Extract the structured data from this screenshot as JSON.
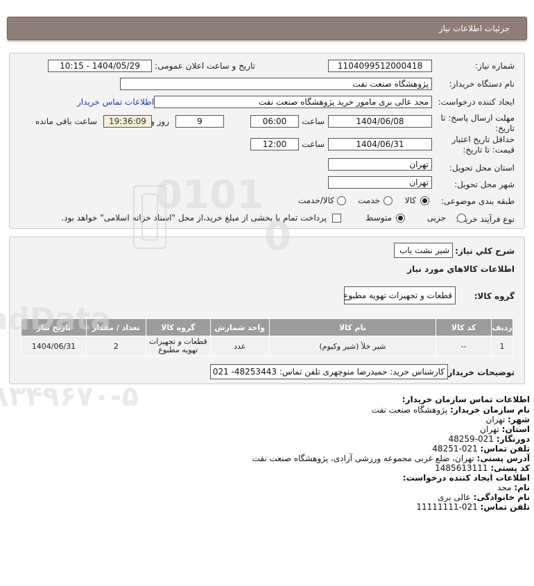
{
  "header": {
    "title": "جزئیات اطلاعات نیاز"
  },
  "form": {
    "need_number_label": "شماره نیاز:",
    "need_number": "1104099512000418",
    "announce_label": "تاریخ و ساعت اعلان عمومی:",
    "announce_value": "1404/05/29 - 10:15",
    "buyer_org_label": "نام دستگاه خریدار:",
    "buyer_org": "پژوهشگاه صنعت نفت",
    "creator_label": "ایجاد کننده درخواست:",
    "creator": "مجد عالی بری مامور خرید پژوهشگاه صنعت نفت",
    "contact_link": "اطلاعات تماس خریدار",
    "deadline_label_1": "مهلت ارسال پاسخ: تا",
    "deadline_label_2": "تاریخ:",
    "deadline_date": "1404/06/08",
    "time_label": "ساعت",
    "deadline_time": "06:00",
    "days": "9",
    "days_label": "روز و",
    "remaining_time": "19:36:09",
    "remaining_label": "ساعت باقی مانده",
    "validity_label_1": "حداقل تاریخ اعتبار",
    "validity_label_2": "قیمت: تا تاریخ:",
    "validity_date": "1404/06/31",
    "validity_time": "12:00",
    "province_label": "استان محل تحویل:",
    "province": "تهران",
    "city_label": "شهر محل تحویل:",
    "city": "تهران",
    "category_label": "طبقه بندی موضوعی:",
    "category_options": [
      "کالا",
      "خدمت",
      "کالا/خدمت"
    ],
    "category_selected": "کالا",
    "process_label": "نوع فرآیند خرید :",
    "process_options": [
      "جزیی",
      "متوسط"
    ],
    "process_selected": "متوسط",
    "payment_note": "پرداخت تمام یا بخشی از مبلغ خرید،از محل \"اسناد خزانه اسلامی\" خواهد بود."
  },
  "details": {
    "summary_label": "شرح کلي نياز:",
    "summary": "شیر نشت یاب",
    "goods_info_title": "اطلاعات کالاهاي مورد نياز",
    "group_label": "گروه کالا:",
    "group": "قطعات و تجهیزات تهویه مطبوع",
    "table": {
      "headers": [
        "ردیف",
        "کد کالا",
        "نام کالا",
        "واحد شمارش",
        "گروه کالا",
        "تعداد / مقدار",
        "تاریخ نیاز"
      ],
      "rows": [
        [
          "1",
          "--",
          "شیر خلأ (شیر وکیوم)",
          "عدد",
          "قطعات و تجهیزات تهویه مطبوع",
          "2",
          "1404/06/31"
        ]
      ]
    },
    "buyer_notes_label": "توضیحات خریدار:",
    "buyer_notes": "کارشناس خرید: حمیدرضا منوچهری تلفن تماس: 48253443- 021"
  },
  "contact": {
    "title": "اطلاعات تماس سازمان خریدار:",
    "org_name_label": "نام سازمان خریدار:",
    "org_name": "پژوهشگاه صنعت نفت",
    "city_label": "شهر:",
    "city": "تهران",
    "province_label": "استان:",
    "province": "تهران",
    "fax_label": "دورنگار:",
    "fax": "021-48259",
    "phone_label": "تلفن تماس:",
    "phone": "021-48251",
    "address_label": "آدرس پستی:",
    "address": "تهران، ضلع غربی مجموعه ورزشی آزادی، پژوهشگاه صنعت نفت",
    "postal_label": "کد پستی:",
    "postal": "1485613111",
    "creator_title": "اطلاعات ایجاد کننده درخواست:",
    "first_name_label": "نام:",
    "first_name": "مجد",
    "last_name_label": "نام خانوادگی:",
    "last_name": "عالی بری",
    "creator_phone_label": "تلفن تماس:",
    "creator_phone": "021-11111111"
  }
}
